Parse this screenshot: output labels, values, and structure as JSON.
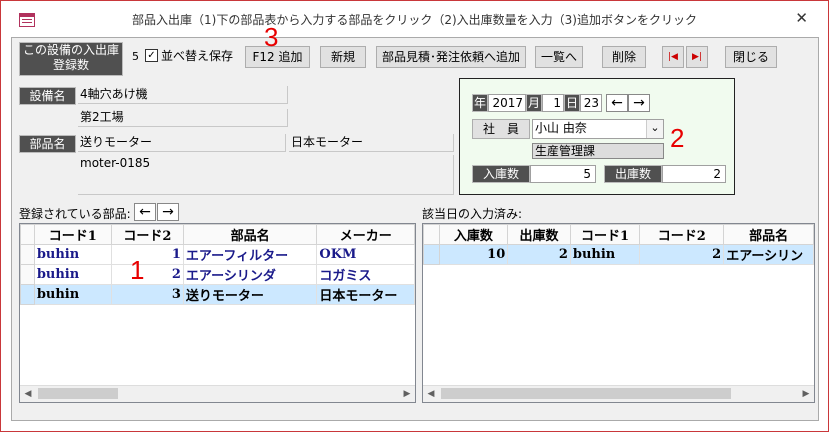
{
  "window": {
    "title": "部品入出庫（1)下の部品表から入力する部品をクリック（2)入出庫数量を入力（3)追加ボタンをクリック",
    "close_glyph": "✕"
  },
  "header": {
    "count_label": "この設備の入出庫登録数",
    "count_value": "5",
    "sort_checkbox_label": "並べ替え保存",
    "sort_checked": true,
    "check_glyph": "✓"
  },
  "toolbar": {
    "add_label": "F12 追加",
    "new_label": "新規",
    "quote_label": "部品見積･発注依頼へ追加",
    "list_label": "一覧へ",
    "delete_label": "削除",
    "first_glyph": "|◀",
    "last_glyph": "▶|",
    "close_label": "閉じる"
  },
  "annotations": {
    "n1": "1",
    "n2": "2",
    "n3": "3"
  },
  "equipment": {
    "label": "設備名",
    "name": "4軸穴あけ機",
    "location": "第2工場"
  },
  "part": {
    "label": "部品名",
    "name": "送りモーター",
    "maker": "日本モーター",
    "model": "moter-0185"
  },
  "entry": {
    "year_label": "年",
    "year": "2017",
    "month_label": "月",
    "month": "1",
    "day_label": "日",
    "day": "23",
    "prev_glyph": "←",
    "next_glyph": "→",
    "employee_label": "社　員",
    "employee": "小山 由奈",
    "dropdown_glyph": "⌄",
    "department": "生産管理課",
    "in_label": "入庫数",
    "in_value": "5",
    "out_label": "出庫数",
    "out_value": "2"
  },
  "registered_parts": {
    "label": "登録されている部品:",
    "prev_glyph": "←",
    "next_glyph": "→",
    "columns": [
      "コード1",
      "コード2",
      "部品名",
      "メーカー"
    ],
    "rows": [
      {
        "code1": "buhin",
        "code2": "1",
        "name": "エアーフィルター",
        "maker": "OKM"
      },
      {
        "code1": "buhin",
        "code2": "2",
        "name": "エアーシリンダ",
        "maker": "コガミス"
      },
      {
        "code1": "buhin",
        "code2": "3",
        "name": "送りモーター",
        "maker": "日本モーター"
      }
    ]
  },
  "today_entries": {
    "label": "該当日の入力済み:",
    "columns": [
      "入庫数",
      "出庫数",
      "コード1",
      "コード2",
      "部品名"
    ],
    "rows": [
      {
        "in": "10",
        "out": "2",
        "code1": "buhin",
        "code2": "2",
        "name": "エアーシリン"
      }
    ]
  },
  "colors": {
    "accent_red": "#e80000",
    "selected_row": "#cce8ff",
    "panel_bg": "#f1fbef"
  }
}
